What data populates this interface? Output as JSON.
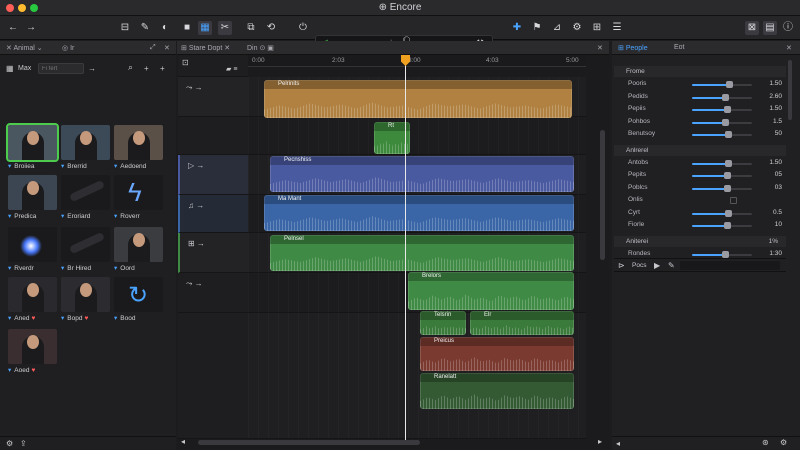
{
  "window": {
    "title": "Encore",
    "close_color": "#ff5f57",
    "min_color": "#febc2e",
    "max_color": "#28c840"
  },
  "toolbar": {
    "left_icons": [
      "back-icon",
      "forward-icon"
    ],
    "tools": [
      "import-icon",
      "keyword-icon",
      "analyze-icon",
      "select-tool-icon",
      "grid-icon",
      "trim-tool-icon",
      "crop-icon",
      "transform-icon",
      "power-icon"
    ],
    "viewer_icons": [
      "audio-meter-icon",
      "zoom-icon",
      "magnify-icon",
      "wand-icon"
    ],
    "right_icons": [
      "marker-icon",
      "flag-icon",
      "pin-icon",
      "effects-icon",
      "list-icon",
      "adjust-icon",
      "share-icon",
      "inspector-icon",
      "info-icon"
    ]
  },
  "library": {
    "tabs": [
      "Animal",
      "Ir"
    ],
    "filter_label": "Max",
    "filter_placeholder": "Fi fert",
    "items": [
      {
        "label": "Broiiea",
        "marker": "",
        "kind": "person"
      },
      {
        "label": "Brerrid",
        "marker": "",
        "kind": "person"
      },
      {
        "label": "Aedoend",
        "marker": "",
        "kind": "person"
      },
      {
        "label": "Predica",
        "marker": "",
        "kind": "person"
      },
      {
        "label": "Eroriard",
        "marker": "",
        "kind": "mic"
      },
      {
        "label": "Roverr",
        "marker": "",
        "kind": "bolt"
      },
      {
        "label": "Rverdr",
        "marker": "",
        "kind": "flare"
      },
      {
        "label": "Br Hired",
        "marker": "",
        "kind": "mic"
      },
      {
        "label": "Oord",
        "marker": "",
        "kind": "person"
      },
      {
        "label": "Aned",
        "marker": "♥",
        "kind": "person"
      },
      {
        "label": "Bopd",
        "marker": "♥",
        "kind": "person"
      },
      {
        "label": "Bood",
        "marker": "",
        "kind": "refresh"
      },
      {
        "label": "Aoed",
        "marker": "♥",
        "kind": "person"
      }
    ]
  },
  "timeline": {
    "tabs": [
      "Stare Dopt",
      "Din"
    ],
    "ruler": [
      "0:00",
      "2:03",
      "3:00",
      "4:03",
      "5:00"
    ],
    "playhead_time": "3:00",
    "clips": [
      {
        "label": "Pelrinits",
        "color": "#b08140"
      },
      {
        "label": "Rt",
        "color": "#3d8a3d"
      },
      {
        "label": "Pecnshiss",
        "color": "#4a5aa0"
      },
      {
        "label": "Ma Mant",
        "color": "#3a66a8"
      },
      {
        "label": "Pelnsel",
        "color": "#3f8a44"
      },
      {
        "label": "Brelors",
        "color": "#3f8a44"
      },
      {
        "label": "Telsrin",
        "color": "#3a7a3a"
      },
      {
        "label": "Elr",
        "color": "#3a7a3a"
      },
      {
        "label": "Preicus",
        "color": "#7a3a30"
      },
      {
        "label": "Ranelatt",
        "color": "#335a33"
      }
    ]
  },
  "inspector": {
    "tabs": [
      "People",
      "Eot"
    ],
    "sections": [
      {
        "title": "Frome",
        "rows": [
          {
            "label": "Pooris",
            "value": "1.50",
            "level": 0.62
          },
          {
            "label": "Pedids",
            "value": "2.60",
            "level": 0.55
          },
          {
            "label": "Pepiis",
            "value": "1.50",
            "level": 0.58
          },
          {
            "label": "Pohbos",
            "value": "1.5",
            "level": 0.55
          },
          {
            "label": "Benutsoy",
            "value": "50",
            "level": 0.6
          }
        ]
      },
      {
        "title": "Anlrerel",
        "rows": [
          {
            "label": "Antobs",
            "value": "1.50",
            "level": 0.6
          },
          {
            "label": "Pepits",
            "value": "05",
            "level": 0.58
          },
          {
            "label": "Poblcs",
            "value": "03",
            "level": 0.58
          },
          {
            "label": "Onlis",
            "value": "",
            "level": 0.0
          },
          {
            "label": "Cyrt",
            "value": "0.5",
            "level": 0.6
          },
          {
            "label": "Fiorle",
            "value": "10",
            "level": 0.58
          }
        ]
      },
      {
        "title": "Aniterei",
        "rows": [
          {
            "label": "Rondes",
            "value": "1:30",
            "level": 0.55
          }
        ]
      }
    ],
    "section_badge": "1%",
    "footer_label": "Pocs"
  }
}
